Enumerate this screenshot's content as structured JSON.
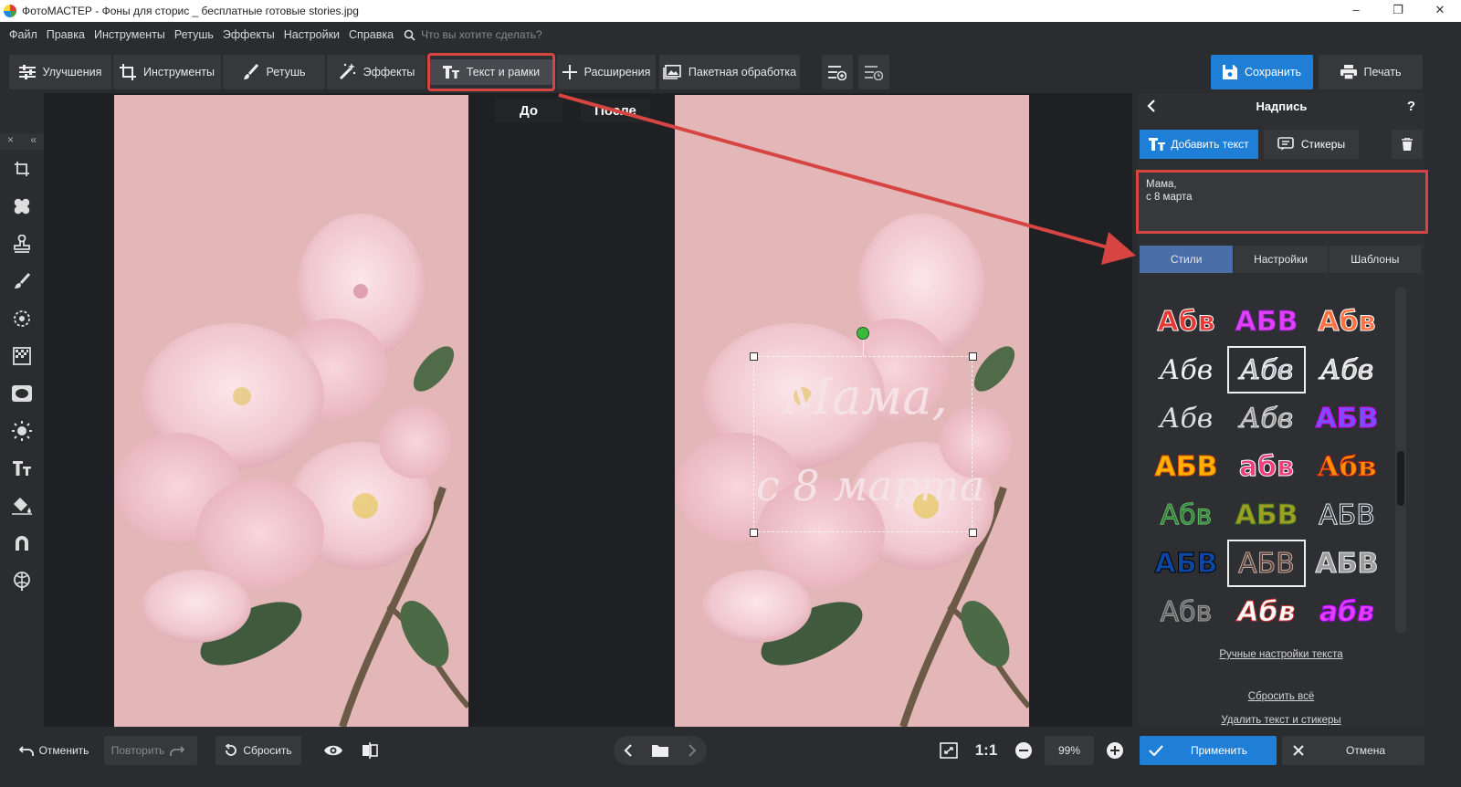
{
  "window": {
    "title": "ФотоМАСТЕР - Фоны для сторис _ бесплатные готовые stories.jpg",
    "min": "–",
    "restore": "❐",
    "close": "✕"
  },
  "menu": {
    "items": [
      "Файл",
      "Правка",
      "Инструменты",
      "Ретушь",
      "Эффекты",
      "Настройки",
      "Справка"
    ],
    "search_placeholder": "Что вы хотите сделать?"
  },
  "toolbar": {
    "improve": "Улучшения",
    "tools": "Инструменты",
    "retouch": "Ретушь",
    "effects": "Эффекты",
    "text_frames": "Текст и рамки",
    "extensions": "Расширения",
    "batch": "Пакетная обработка",
    "save": "Сохранить",
    "print": "Печать"
  },
  "compare": {
    "before": "До",
    "after": "После"
  },
  "overlay_text": {
    "line1": "Мама,",
    "line2": "с 8 марта"
  },
  "panel": {
    "title": "Надпись",
    "help": "?",
    "add_text": "Добавить текст",
    "stickers": "Стикеры",
    "text_value": "Мама,\nс 8 марта",
    "tabs": [
      "Стили",
      "Настройки",
      "Шаблоны"
    ],
    "active_tab": "Стили",
    "manual_link": "Ручные настройки текста",
    "reset_all": "Сбросить всё",
    "delete_all": "Удалить текст и стикеры"
  },
  "styles": [
    {
      "text": "Абв",
      "color": "#e53935",
      "stroke": "#ffffff",
      "font": "sans",
      "weight": "bold"
    },
    {
      "text": "АБВ",
      "color": "#e040fb",
      "stroke": "#7b1fa2",
      "font": "sans",
      "weight": "bold"
    },
    {
      "text": "Абв",
      "color": "#ff7043",
      "stroke": "#ffffff",
      "font": "sans",
      "weight": "bold"
    },
    {
      "text": "Абв",
      "color": "#f0f0f0",
      "stroke": "none",
      "font": "serif",
      "weight": "normal",
      "italic": true
    },
    {
      "text": "Абв",
      "color": "#b0b0c0",
      "stroke": "#ffffff",
      "font": "serif",
      "weight": "normal",
      "italic": true,
      "selected": true
    },
    {
      "text": "Абв",
      "color": "#cfcfcf",
      "stroke": "#ffffff",
      "font": "serif",
      "weight": "normal",
      "italic": true
    },
    {
      "text": "Абв",
      "color": "#dddddd",
      "stroke": "none",
      "font": "serif",
      "weight": "normal",
      "italic": true
    },
    {
      "text": "Абв",
      "color": "#9a9a9a",
      "stroke": "#dddddd",
      "font": "serif",
      "weight": "normal",
      "italic": true
    },
    {
      "text": "АБВ",
      "color": "#7c4dff",
      "stroke": "#d500f9",
      "font": "sans",
      "weight": "bold"
    },
    {
      "text": "АБВ",
      "color": "#ffb300",
      "stroke": "#e65100",
      "font": "sans",
      "weight": "bold"
    },
    {
      "text": "абв",
      "color": "#ec407a",
      "stroke": "#ffffff",
      "font": "sans",
      "weight": "bold"
    },
    {
      "text": "Абв",
      "color": "#ff8f00",
      "stroke": "#b71c1c",
      "font": "serif",
      "weight": "bold"
    },
    {
      "text": "Абв",
      "color": "#2e7d32",
      "stroke": "#66bb6a",
      "font": "sans",
      "weight": "normal"
    },
    {
      "text": "АБВ",
      "color": "#9e9d24",
      "stroke": "#33691e",
      "font": "sans",
      "weight": "bold"
    },
    {
      "text": "АБВ",
      "color": "#263238",
      "stroke": "#eceff1",
      "font": "sans",
      "weight": "normal"
    },
    {
      "text": "АБВ",
      "color": "#0d47a1",
      "stroke": "#000000",
      "font": "sans",
      "weight": "bold"
    },
    {
      "text": "АБВ",
      "color": "#5d4037",
      "stroke": "#bcaaa4",
      "font": "sans",
      "weight": "normal",
      "selected": true
    },
    {
      "text": "АБВ",
      "color": "#9e9e9e",
      "stroke": "#eeeeee",
      "font": "sans",
      "weight": "bold"
    },
    {
      "text": "Абв",
      "color": "#616161",
      "stroke": "#9e9e9e",
      "font": "sans",
      "weight": "normal"
    },
    {
      "text": "Абв",
      "color": "#ffffff",
      "stroke": "#d32f2f",
      "font": "sans",
      "weight": "bold",
      "italic": true
    },
    {
      "text": "абв",
      "color": "#e040fb",
      "stroke": "#aa00ff",
      "font": "sans",
      "weight": "bold",
      "italic": true
    }
  ],
  "bottom": {
    "undo": "Отменить",
    "redo": "Повторить",
    "reset": "Сбросить",
    "ratio": "1:1",
    "zoom": "99%",
    "apply": "Применить",
    "cancel": "Отмена"
  },
  "colors": {
    "accent": "#1f7fd6",
    "highlight": "#d64541",
    "tab_active": "#4a6fa8"
  }
}
